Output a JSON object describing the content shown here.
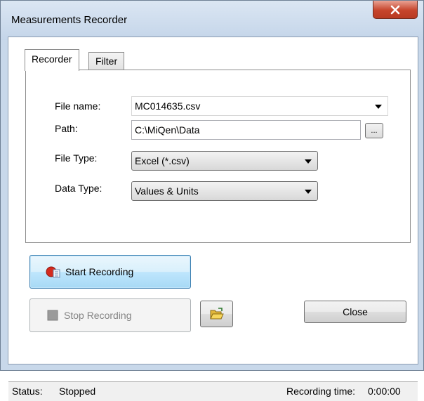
{
  "window": {
    "title": "Measurements Recorder",
    "close_glyph": "X"
  },
  "tabs": [
    {
      "label": "Recorder",
      "active": true
    },
    {
      "label": "Filter",
      "active": false
    }
  ],
  "form": {
    "file_name_label": "File name:",
    "file_name_value": "MC014635.csv",
    "path_label": "Path:",
    "path_value": "C:\\MiQen\\Data",
    "browse_label": "...",
    "file_type_label": "File Type:",
    "file_type_value": "Excel (*.csv)",
    "data_type_label": "Data Type:",
    "data_type_value": "Values & Units"
  },
  "buttons": {
    "start_label": "Start Recording",
    "stop_label": "Stop Recording",
    "close_label": "Close",
    "start_icon": "record-icon",
    "stop_icon": "stop-icon",
    "open_folder_icon": "open-folder-icon"
  },
  "status": {
    "status_label": "Status:",
    "status_value": "Stopped",
    "time_label": "Recording time:",
    "time_value": "0:00:00"
  },
  "colors": {
    "close_button": "#c6442b",
    "focus_button": "#bee6fd",
    "record_red": "#d42a1e"
  }
}
